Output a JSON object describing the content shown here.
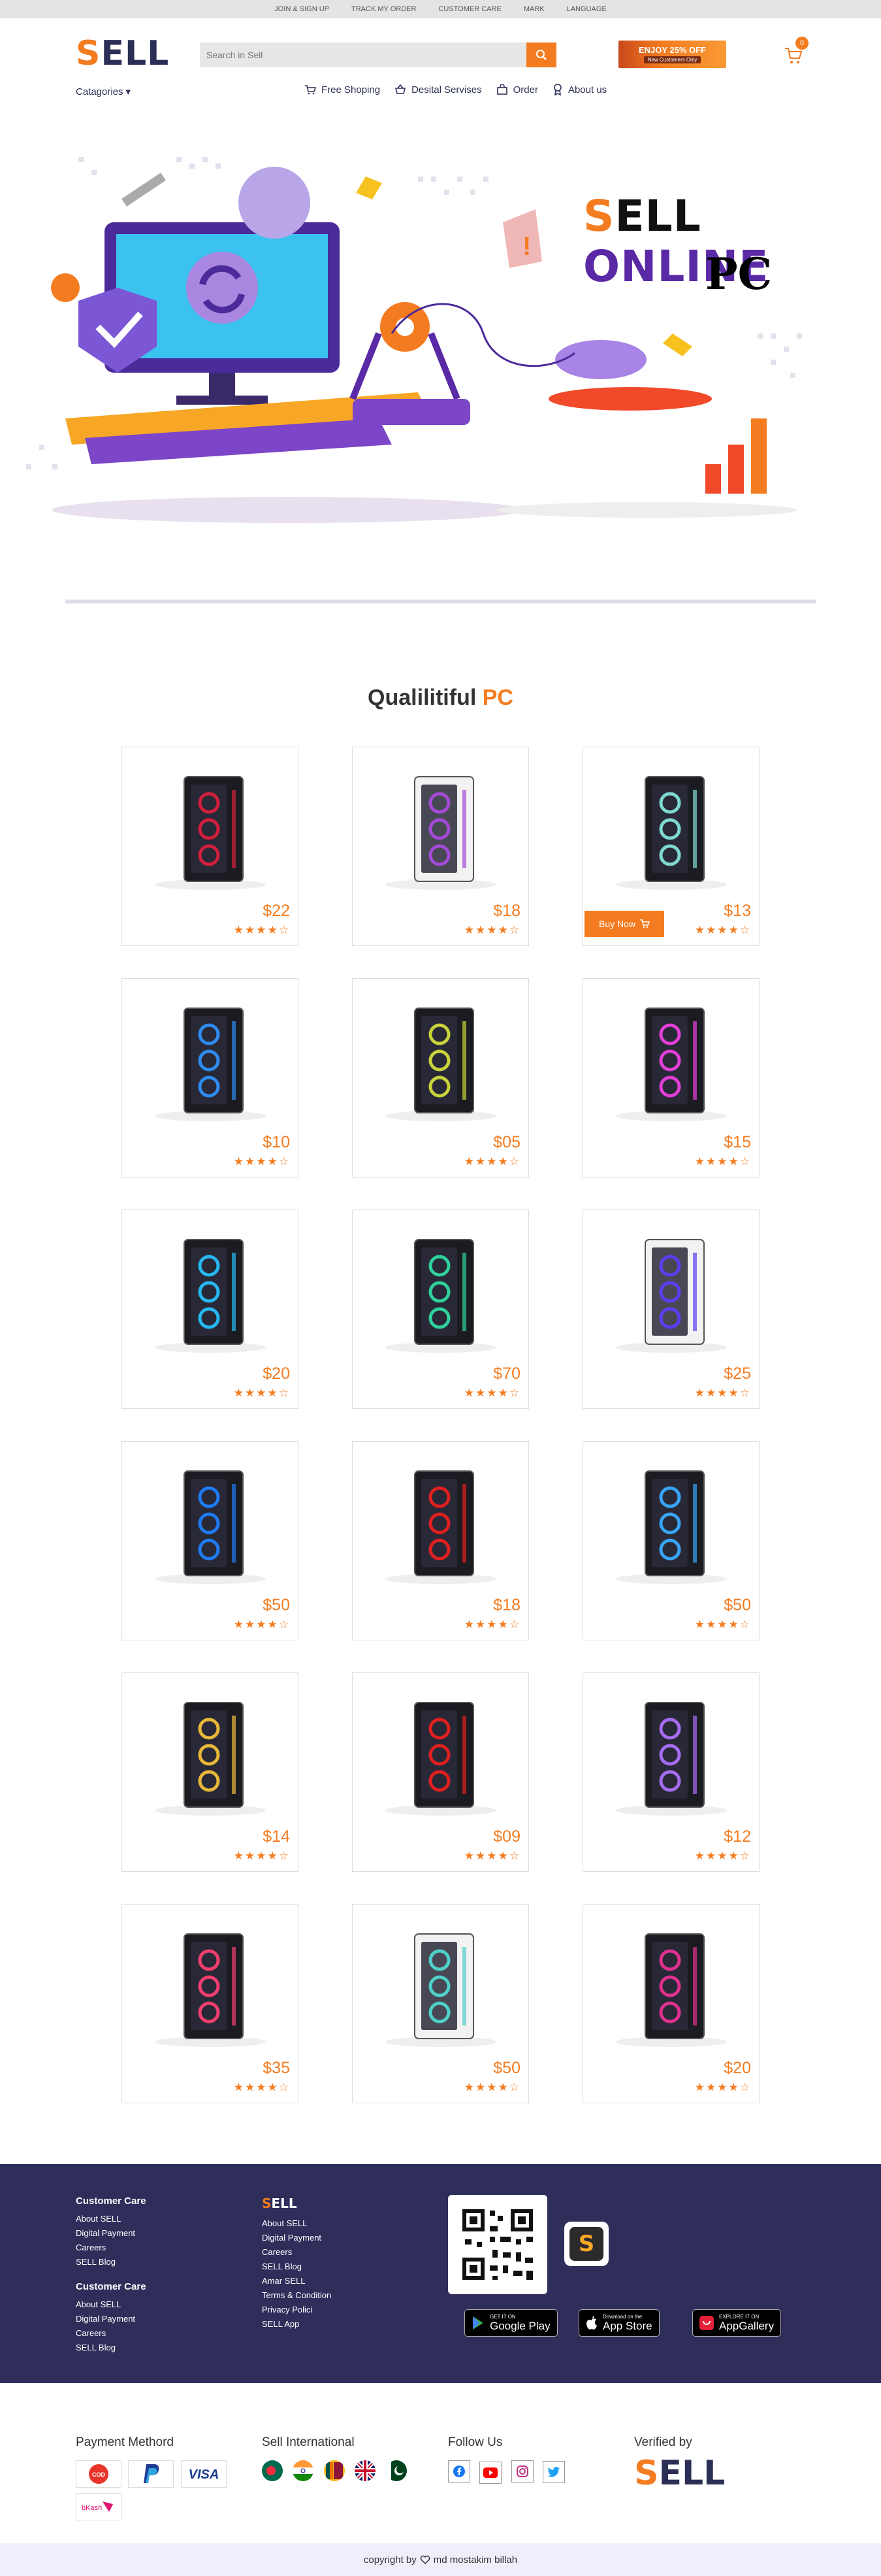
{
  "topbar": {
    "items": [
      "JOIN & SIGN UP",
      "TRACK MY ORDER",
      "CUSTOMER CARE",
      "MARK",
      "LANGUAGE"
    ]
  },
  "brand": {
    "first": "S",
    "rest": "ELL"
  },
  "header": {
    "categories_label": "Catagories",
    "search_placeholder": "Search in Sell",
    "promo_title": "ENJOY 25% OFF",
    "promo_sub": "New Customers Only",
    "cart_count": "0"
  },
  "nav": [
    "Free Shoping",
    "Desital Servises",
    "Order",
    "About us"
  ],
  "hero": {
    "title_s": "S",
    "title_ell": "ELL",
    "title_online": " ONLINE",
    "subtitle": "PC"
  },
  "section": {
    "title": "Qualilitiful ",
    "accent": "PC"
  },
  "products": [
    {
      "price": "$22",
      "rating": 4,
      "color": "#d21f3c"
    },
    {
      "price": "$18",
      "rating": 4,
      "color": "#a44bd6"
    },
    {
      "price": "$13",
      "rating": 4,
      "color": "#7fd9d0"
    },
    {
      "price": "$10",
      "rating": 4,
      "color": "#2e8cf0"
    },
    {
      "price": "$05",
      "rating": 4,
      "color": "#c9d23a"
    },
    {
      "price": "$15",
      "rating": 4,
      "color": "#e23fd6"
    },
    {
      "price": "$20",
      "rating": 4,
      "color": "#25b8f2"
    },
    {
      "price": "$70",
      "rating": 4,
      "color": "#2fd19a"
    },
    {
      "price": "$25",
      "rating": 4,
      "color": "#5b3ef0"
    },
    {
      "price": "$50",
      "rating": 4,
      "color": "#1f7bf2"
    },
    {
      "price": "$18",
      "rating": 4,
      "color": "#e02020"
    },
    {
      "price": "$50",
      "rating": 4,
      "color": "#38a4f5"
    },
    {
      "price": "$14",
      "rating": 4,
      "color": "#e8b73a"
    },
    {
      "price": "$09",
      "rating": 4,
      "color": "#e01f1f"
    },
    {
      "price": "$12",
      "rating": 4,
      "color": "#a66cf0"
    },
    {
      "price": "$35",
      "rating": 4,
      "color": "#f23f6f"
    },
    {
      "price": "$50",
      "rating": 4,
      "color": "#4fd0c8"
    },
    {
      "price": "$20",
      "rating": 4,
      "color": "#e0308f"
    }
  ],
  "buy_now_label": "Buy Now",
  "footer": {
    "col1_title": "Customer Care",
    "col1_links": [
      "About SELL",
      "Digital Payment",
      "Careers",
      "SELL Blog"
    ],
    "col1b_title": "Customer Care",
    "col1b_links": [
      "About SELL",
      "Digital Payment",
      "Careers",
      "SELL Blog"
    ],
    "col2_links": [
      "About SELL",
      "Digital Payment",
      "Careers",
      "SELL Blog",
      "Amar SELL",
      "Terms & Condition",
      "Privacy Polici",
      "SELL App"
    ],
    "stores": [
      {
        "small": "GET IT ON",
        "big": "Google Play"
      },
      {
        "small": "Download on the",
        "big": "App Store"
      },
      {
        "small": "EXPLORE IT ON",
        "big": "AppGallery"
      }
    ]
  },
  "bottom": {
    "payment_title": "Payment Methord",
    "intl_title": "Sell International",
    "follow_title": "Follow Us",
    "verified_title": "Verified by"
  },
  "copyright": {
    "before": "copyright by",
    "after": "md mostakim billah"
  },
  "colors": {
    "accent": "#f47c20",
    "navy": "#2f2d5a",
    "purple": "#5a2aa6"
  }
}
